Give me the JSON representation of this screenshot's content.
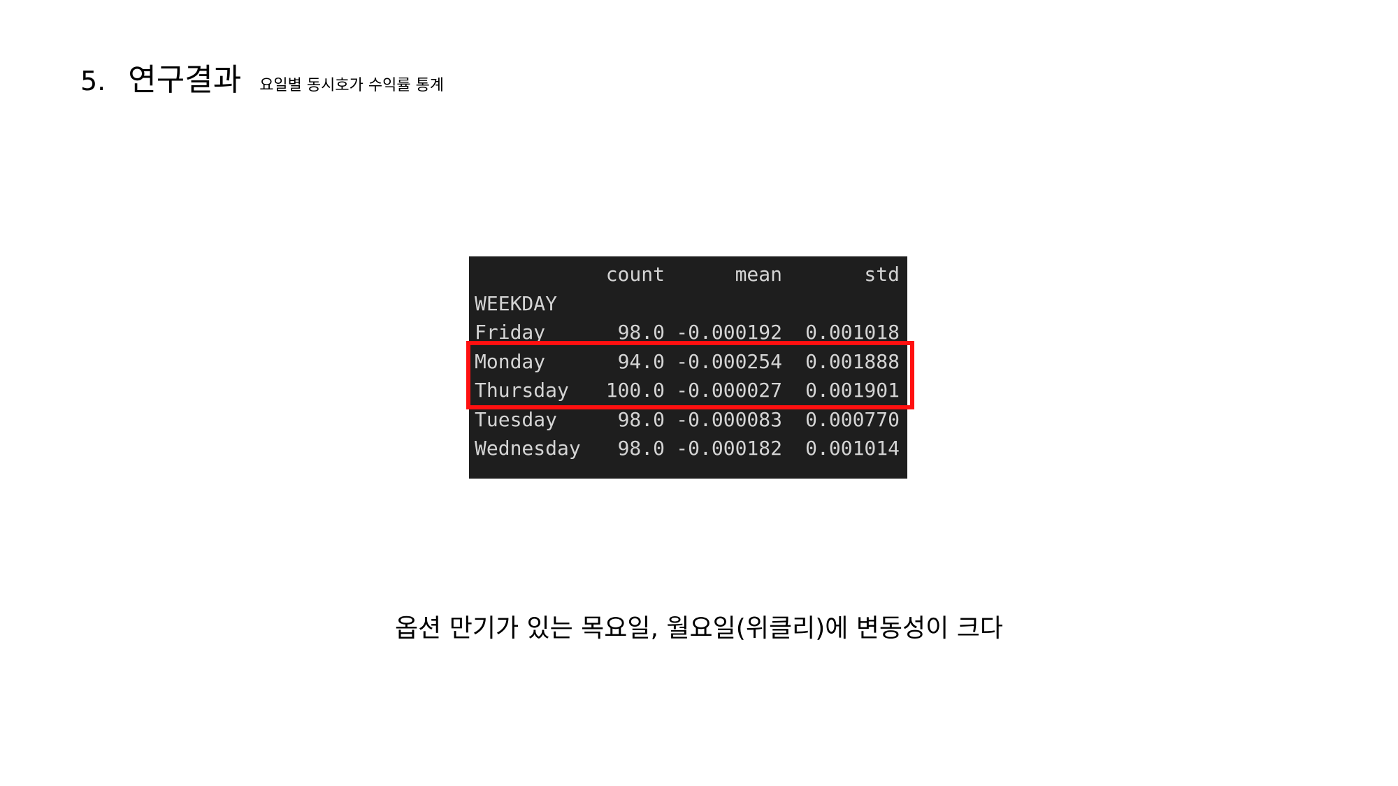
{
  "heading": {
    "number": "5.",
    "title": "연구결과",
    "subtitle": "요일별 동시호가 수익률 통계"
  },
  "table": {
    "columns": [
      "",
      "count",
      "mean",
      "std"
    ],
    "index_name": "WEEKDAY",
    "rows": [
      {
        "day": "Friday",
        "count": "98.0",
        "mean": "-0.000192",
        "std": "0.001018"
      },
      {
        "day": "Monday",
        "count": "94.0",
        "mean": "-0.000254",
        "std": "0.001888"
      },
      {
        "day": "Thursday",
        "count": "100.0",
        "mean": "-0.000027",
        "std": "0.001901"
      },
      {
        "day": "Tuesday",
        "count": "98.0",
        "mean": "-0.000083",
        "std": "0.000770"
      },
      {
        "day": "Wednesday",
        "count": "98.0",
        "mean": "-0.000182",
        "std": "0.001014"
      }
    ],
    "highlighted_rows": [
      "Monday",
      "Thursday"
    ]
  },
  "caption": "옵션 만기가 있는 목요일, 월요일(위클리)에 변동성이 크다",
  "colors": {
    "table_background": "#1e1e1e",
    "table_text": "#d4d4d4",
    "highlight": "#ff1010"
  }
}
